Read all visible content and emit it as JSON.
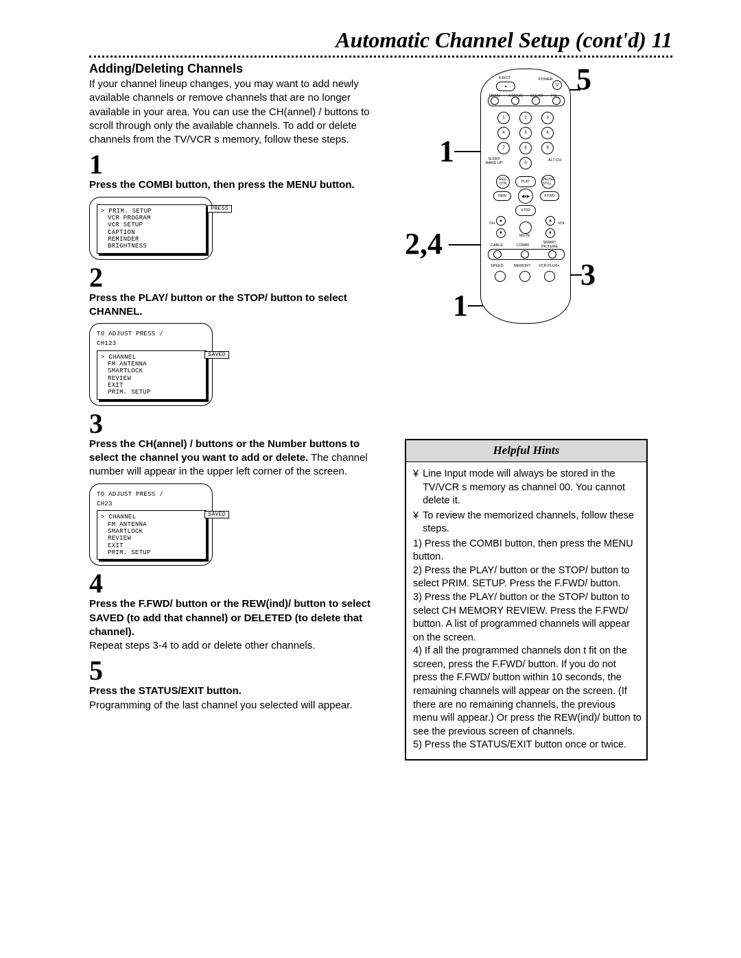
{
  "header": "Automatic Channel Setup (cont'd)  11",
  "section_title": "Adding/Deleting Channels",
  "intro": "If your channel lineup changes, you may want to add newly available channels or remove channels that are no longer available in your area. You can use the CH(annel)   /   buttons to scroll through only the available channels. To add or delete channels from the TV/VCR s memory, follow these steps.",
  "steps": {
    "s1": {
      "num": "1",
      "text": "Press the COMBI button, then press the MENU button."
    },
    "s2": {
      "num": "2",
      "text": "Press the PLAY/   button or the STOP/   button to select CHANNEL."
    },
    "s3": {
      "num": "3",
      "bold": "Press the CH(annel)   /   buttons or the Number buttons to select the channel you want to add or delete.",
      "rest": " The channel number will appear in the upper left corner of the screen."
    },
    "s4": {
      "num": "4",
      "bold": "Press the F.FWD/   button or the REW(ind)/   button to select SAVED (to add that channel) or DELETED (to delete that channel).",
      "rest": "Repeat steps 3-4 to add or delete other channels."
    },
    "s5": {
      "num": "5",
      "bold": "Press the STATUS/EXIT button.",
      "rest": "Programming of the last channel you selected will appear."
    }
  },
  "screen1": {
    "lines": [
      "PRIM. SETUP",
      "VCR PROGRAM",
      "VCR SETUP",
      "CAPTION",
      "REMINDER",
      "BRIGHTNESS"
    ],
    "badge": "PRESS"
  },
  "screen2": {
    "pre": [
      "TO ADJUST PRESS    /",
      "CH123"
    ],
    "lines": [
      "CHANNEL",
      "FM ANTENNA",
      "SMARTLOCK",
      "REVIEW",
      "EXIT",
      "PRIM. SETUP"
    ],
    "badge": "SAVED"
  },
  "screen3": {
    "pre": [
      "TO ADJUST PRESS    /",
      "CH23"
    ],
    "lines": [
      "CHANNEL",
      "FM ANTENNA",
      "SMARTLOCK",
      "REVIEW",
      "EXIT",
      "PRIM. SETUP"
    ],
    "badge": "SAVED"
  },
  "remote": {
    "eject": "EJECT",
    "power": "POWER",
    "row_small": [
      "MENU",
      "STATUS",
      "CLEAR",
      "FM"
    ],
    "nums": [
      "1",
      "2",
      "3",
      "4",
      "5",
      "6",
      "7",
      "8",
      "9",
      "0"
    ],
    "sleep": "SLEEP\nWAKE UP",
    "altch": "ALT CH",
    "rec": "REC\nOTR",
    "play": "PLAY",
    "pause": "PAUSE\nSTILL",
    "rew": "REW",
    "ffwd": "F.FWD",
    "stop": "STOP",
    "ch": "CH",
    "vol": "VOL",
    "mute": "MUTE",
    "cable": "CABLE",
    "combi": "COMBI",
    "smart": "SMART\nPICTURE",
    "speed": "SPEED",
    "memory": "MEMORY",
    "vcrplus": "VCR PLUS+"
  },
  "callouts": {
    "c5": "5",
    "c1a": "1",
    "c24": "2,4",
    "c3": "3",
    "c1b": "1"
  },
  "hints": {
    "title": "Helpful Hints",
    "b1": "Line Input mode will always be stored in the TV/VCR s memory as channel 00. You cannot delete it.",
    "b2": "To review the memorized channels, follow these steps.",
    "l1": "1) Press the COMBI button, then press the MENU button.",
    "l2": "2) Press the PLAY/ button or the STOP/ button to select PRIM. SETUP. Press the F.FWD/ button.",
    "l3": "3) Press the PLAY/ button or the STOP/ button to select CH MEMORY REVIEW. Press the F.FWD/ button. A list of programmed channels will appear on the screen.",
    "l4": "4) If all the programmed channels don t fit on the screen, press the F.FWD/ button. If you do not press the F.FWD/ button within 10 seconds, the remaining channels will appear on the screen. (If there are no remaining channels, the previous menu will appear.) Or press the REW(ind)/ button to see the previous screen of channels.",
    "l5": "5) Press the STATUS/EXIT button once or twice."
  }
}
